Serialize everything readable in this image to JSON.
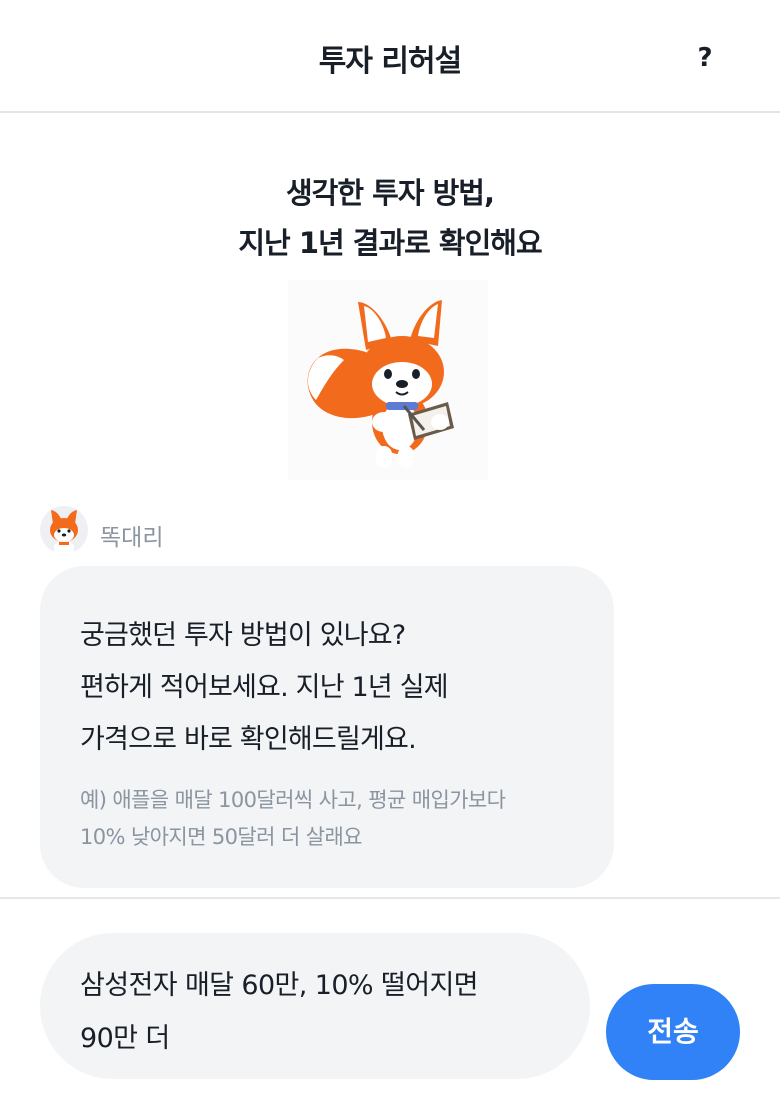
{
  "header": {
    "title": "투자 리허설",
    "help_label": "?"
  },
  "hero": {
    "headline_line1": "생각한 투자 방법,",
    "headline_line2": "지난 1년 결과로 확인해요",
    "mascot_icon": "fox-mascot-writing-notebook"
  },
  "bot": {
    "name": "똑대리",
    "avatar_icon": "fox-avatar"
  },
  "message": {
    "lines": [
      "궁금했던 투자 방법이 있나요?",
      "편하게 적어보세요. 지난 1년 실제",
      "가격으로 바로 확인해드릴게요."
    ],
    "example_lines": [
      "예) 애플을 매달 100달러씩 사고, 평균 매입가보다",
      "10% 낮아지면 50달러 더 살래요"
    ]
  },
  "composer": {
    "input_lines": [
      "삼성전자 매달 60만, 10% 떨어지면",
      "90만 더"
    ],
    "send_label": "전송"
  },
  "colors": {
    "accent": "#3182f6",
    "bubble_bg": "#f2f4f6",
    "text_primary": "#191f28",
    "text_secondary": "#8b95a1",
    "fox_orange": "#f26a1b"
  }
}
